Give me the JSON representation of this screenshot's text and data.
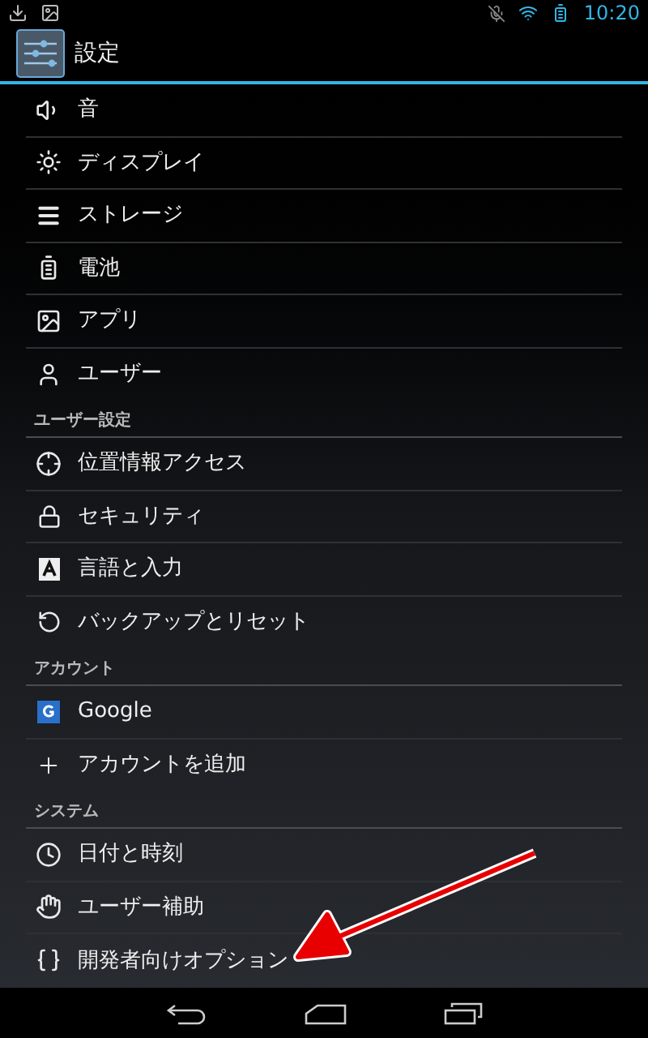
{
  "status_bar": {
    "time": "10:20"
  },
  "action_bar": {
    "title": "設定"
  },
  "sections": [
    {
      "items": [
        {
          "label": "音"
        },
        {
          "label": "ディスプレイ"
        },
        {
          "label": "ストレージ"
        },
        {
          "label": "電池"
        },
        {
          "label": "アプリ"
        },
        {
          "label": "ユーザー"
        }
      ]
    },
    {
      "header": "ユーザー設定",
      "items": [
        {
          "label": "位置情報アクセス"
        },
        {
          "label": "セキュリティ"
        },
        {
          "label": "言語と入力"
        },
        {
          "label": "バックアップとリセット"
        }
      ]
    },
    {
      "header": "アカウント",
      "items": [
        {
          "label": "Google"
        },
        {
          "label": "アカウントを追加"
        }
      ]
    },
    {
      "header": "システム",
      "items": [
        {
          "label": "日付と時刻"
        },
        {
          "label": "ユーザー補助"
        },
        {
          "label": "開発者向けオプション"
        }
      ]
    }
  ]
}
